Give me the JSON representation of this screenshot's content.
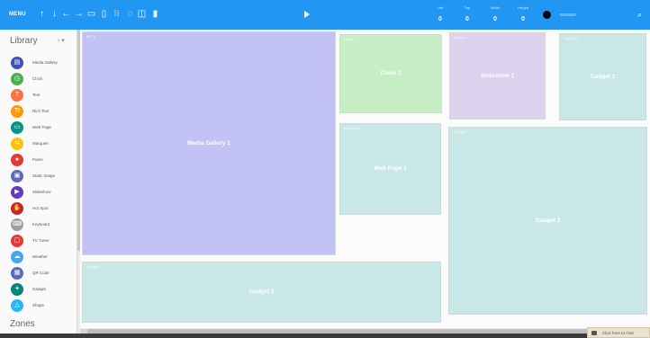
{
  "toolbar": {
    "menu_label": "MENU",
    "tools": [
      "arrow-up-icon",
      "arrow-down-icon",
      "arrow-left-icon",
      "arrow-right-icon",
      "align-horizontal-icon",
      "align-vertical-icon",
      "grid-icon",
      "copy-icon",
      "duplicate-icon",
      "delete-icon"
    ],
    "tool_glyphs": [
      "↑",
      "↓",
      "←",
      "→",
      "▭",
      "▯",
      "⁝⁝",
      "◌",
      "◫",
      "▮"
    ],
    "play_icon": "play-icon",
    "fields": [
      {
        "label": "Left",
        "value": "0"
      },
      {
        "label": "Top",
        "value": "0"
      },
      {
        "label": "Width",
        "value": "0"
      },
      {
        "label": "Height",
        "value": "0"
      }
    ],
    "color_hex": "#000000",
    "zoom_icon": "search-icon"
  },
  "sidebar": {
    "title": "Library",
    "collapse_label": "‹ ▾",
    "zones_label": "Zones",
    "items": [
      {
        "label": "Media Gallery",
        "color": "#3f51b5",
        "glyph": "▤"
      },
      {
        "label": "Clock",
        "color": "#4caf50",
        "glyph": "◷"
      },
      {
        "label": "Text",
        "color": "#ff7043",
        "glyph": "T"
      },
      {
        "label": "Rich Text",
        "color": "#ff9800",
        "glyph": "Tt"
      },
      {
        "label": "Web Page",
        "color": "#009688",
        "glyph": "▭"
      },
      {
        "label": "Marquee",
        "color": "#ffc107",
        "glyph": "⇆"
      },
      {
        "label": "Poem",
        "color": "#e53935",
        "glyph": "●"
      },
      {
        "label": "Static Image",
        "color": "#5c6bc0",
        "glyph": "▣"
      },
      {
        "label": "Slideshow",
        "color": "#673ab7",
        "glyph": "▶"
      },
      {
        "label": "Hot Spot",
        "color": "#c62828",
        "glyph": "✋"
      },
      {
        "label": "Keyboard",
        "color": "#9e9e9e",
        "glyph": "⌨"
      },
      {
        "label": "TV Tuner",
        "color": "#e53935",
        "glyph": "▢"
      },
      {
        "label": "Weather",
        "color": "#42a5f5",
        "glyph": "☁"
      },
      {
        "label": "QR Code",
        "color": "#5c6bc0",
        "glyph": "▦"
      },
      {
        "label": "Gadget",
        "color": "#00897b",
        "glyph": "✦"
      },
      {
        "label": "Shape",
        "color": "#29b6f6",
        "glyph": "△"
      }
    ]
  },
  "canvas": {
    "widgets": [
      {
        "id": "media-gallery",
        "tag": "MG 1",
        "name": "Media Gallery 1",
        "color": "#c3c2f5"
      },
      {
        "id": "clock",
        "tag": "Clock 1",
        "name": "Clock 1",
        "color": "#c6eec4"
      },
      {
        "id": "slideshow",
        "tag": "Slides 1",
        "name": "Slideshow 1",
        "color": "#dcd2ee"
      },
      {
        "id": "gadget-top",
        "tag": "Gadget 1",
        "name": "Gadget 1",
        "color": "#c9e7e7"
      },
      {
        "id": "web-page",
        "tag": "Web Page 1",
        "name": "Web Page 1",
        "color": "#c9e7e7"
      },
      {
        "id": "gadget-right",
        "tag": "Gadget 2",
        "name": "Gadget 2",
        "color": "#c9e7e7"
      },
      {
        "id": "gadget-bottom",
        "tag": "Gadget 3",
        "name": "Gadget 3",
        "color": "#c9e7e7"
      }
    ]
  },
  "help_button": {
    "label": "Click here to chat"
  }
}
